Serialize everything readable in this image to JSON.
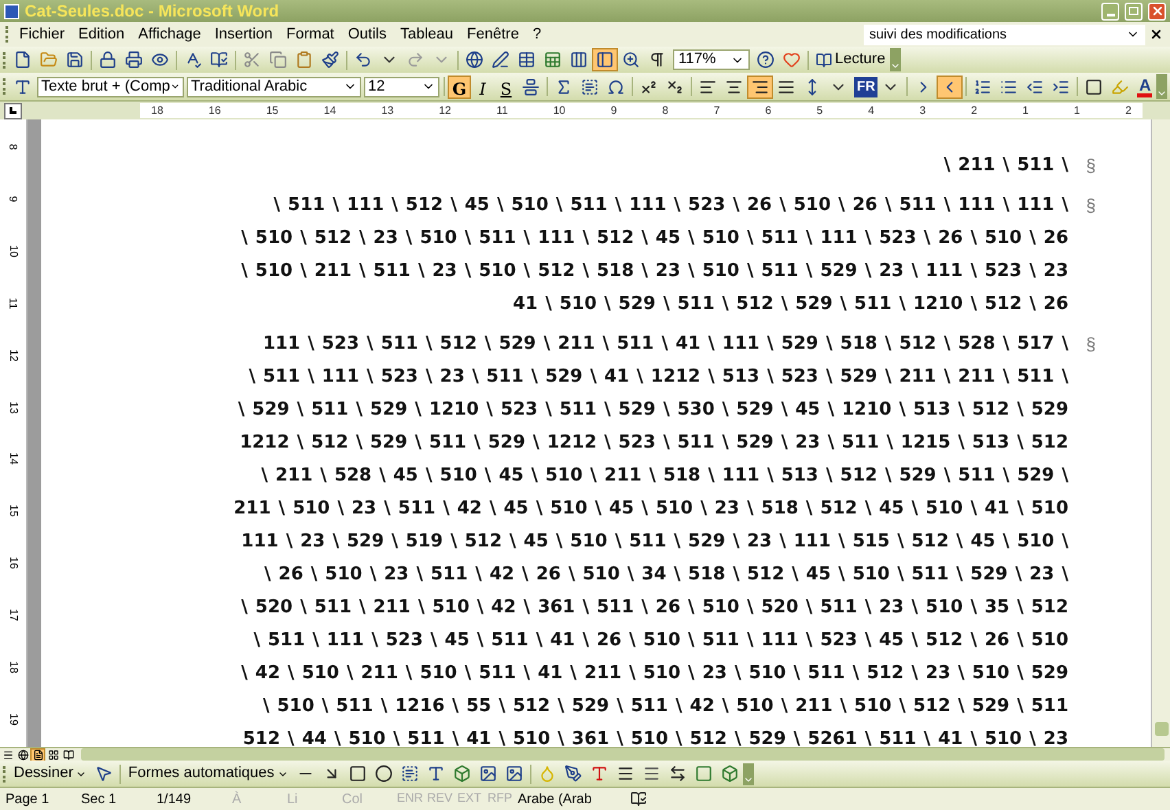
{
  "window": {
    "title": "Cat-Seules.doc - Microsoft Word"
  },
  "menu": [
    "Fichier",
    "Edition",
    "Affichage",
    "Insertion",
    "Format",
    "Outils",
    "Tableau",
    "Fenêtre",
    "?"
  ],
  "help_box": {
    "value": "suivi des modifications"
  },
  "standard_toolbar": {
    "zoom": "117%",
    "reading_button": "Lecture",
    "document_map": {
      "selected": true
    }
  },
  "formatting_toolbar": {
    "style": "Texte brut + (Comp",
    "font": "Traditional Arabic",
    "size": "12",
    "style_buttons": [
      {
        "label": "G",
        "selected": true
      },
      {
        "label": "I",
        "selected": false
      },
      {
        "label": "S",
        "selected": false
      }
    ],
    "align_buttons": [
      {
        "selected": false
      },
      {
        "selected": false
      },
      {
        "selected": true
      },
      {
        "selected": false
      }
    ],
    "language": "FR",
    "direction_buttons": [
      {
        "selected": false
      },
      {
        "selected": true
      }
    ],
    "font_color_label": "A"
  },
  "ruler": [
    "18",
    "16",
    "15",
    "14",
    "13",
    "12",
    "11",
    "10",
    "9",
    "8",
    "7",
    "6",
    "5",
    "4",
    "3",
    "2",
    "1",
    "1",
    "2"
  ],
  "vertical_ruler": [
    "8",
    "9",
    "10",
    "11",
    "12",
    "13",
    "14",
    "15",
    "16",
    "17",
    "18",
    "19"
  ],
  "document": {
    "paragraphs": [
      {
        "mark": "§",
        "lines": [
          "\\ 211 \\ 511 \\"
        ]
      },
      {
        "mark": "§",
        "lines": [
          "\\ 511 \\ 111 \\ 512 \\ 45 \\ 510 \\ 511 \\ 111 \\ 523 \\ 26 \\ 510 \\ 26 \\ 511 \\ 111 \\ 111 \\",
          "\\ 510 \\ 512 \\ 23 \\ 510 \\ 511 \\ 111 \\ 512 \\ 45 \\ 510 \\ 511 \\ 111 \\ 523 \\ 26 \\ 510 \\ 26",
          "\\ 510 \\ 211 \\ 511 \\ 23 \\ 510 \\ 512 \\ 518 \\ 23 \\ 510 \\ 511 \\ 529 \\ 23 \\ 111 \\ 523 \\ 23",
          "41 \\ 510 \\ 529 \\ 511 \\ 512 \\ 529 \\ 511 \\ 1210 \\ 512 \\ 26"
        ]
      },
      {
        "mark": "§",
        "lines": [
          "111 \\ 523 \\ 511 \\ 512 \\ 529 \\ 211 \\ 511 \\ 41 \\ 111 \\ 529 \\ 518 \\ 512 \\ 528 \\ 517 \\",
          "\\ 511 \\ 111 \\ 523 \\ 23 \\ 511 \\ 529 \\ 41 \\ 1212 \\ 513 \\ 523 \\ 529 \\ 211 \\ 211 \\ 511 \\",
          "\\ 529 \\ 511 \\ 529 \\ 1210 \\ 523 \\ 511 \\ 529 \\ 530 \\ 529 \\ 45 \\ 1210 \\ 513 \\ 512 \\ 529",
          "1212 \\ 512 \\ 529 \\ 511 \\ 529 \\ 1212 \\ 523 \\ 511 \\ 529 \\ 23 \\ 511 \\ 1215 \\ 513 \\ 512",
          "\\ 211 \\ 528 \\ 45 \\ 510 \\ 45 \\ 510 \\ 211 \\ 518 \\ 111 \\ 513 \\ 512 \\ 529 \\ 511 \\ 529 \\",
          "211 \\ 510 \\ 23 \\ 511 \\ 42 \\ 45 \\ 510 \\ 45 \\ 510 \\ 23 \\ 518 \\ 512 \\ 45 \\ 510 \\ 41 \\ 510",
          "111 \\ 23 \\ 529 \\ 519 \\ 512 \\ 45 \\ 510 \\ 511 \\ 529 \\ 23 \\ 111 \\ 515 \\ 512 \\ 45 \\ 510 \\",
          "\\ 26 \\ 510 \\ 23 \\ 511 \\ 42 \\ 26 \\ 510 \\ 34 \\ 518 \\ 512 \\ 45 \\ 510 \\ 511 \\ 529 \\ 23 \\",
          "\\ 520 \\ 511 \\ 211 \\ 510 \\ 42 \\ 361 \\ 511 \\ 26 \\ 510 \\ 520 \\ 511 \\ 23 \\ 510 \\ 35 \\ 512",
          "\\ 511 \\ 111 \\ 523 \\ 45 \\ 511 \\ 41 \\ 26 \\ 510 \\ 511 \\ 111 \\ 523 \\ 45 \\ 512 \\ 26 \\ 510",
          "\\ 42 \\ 510 \\ 211 \\ 510 \\ 511 \\ 41 \\ 211 \\ 510 \\ 23 \\ 510 \\ 511 \\ 512 \\ 23 \\ 510 \\ 529",
          "\\ 510 \\ 511 \\ 1216 \\ 55 \\ 512 \\ 529 \\ 511 \\ 42 \\ 510 \\ 211 \\ 510 \\ 512 \\ 529 \\ 511",
          "512 \\ 44 \\ 510 \\ 511 \\ 41 \\ 510 \\ 361 \\ 510 \\ 512 \\ 529 \\ 5261 \\ 511 \\ 41 \\ 510 \\ 23"
        ]
      }
    ]
  },
  "view_buttons": [
    {
      "selected": false
    },
    {
      "selected": false
    },
    {
      "selected": true
    },
    {
      "selected": false
    },
    {
      "selected": false
    }
  ],
  "drawing_toolbar": {
    "draw_menu": "Dessiner",
    "autoshapes_menu": "Formes automatiques"
  },
  "status_bar": [
    "Page 1",
    "Sec 1",
    "1/149",
    "À",
    "Li",
    "Col",
    "ENR",
    "REV",
    "EXT",
    "RFP",
    "Arabe (Arab"
  ]
}
